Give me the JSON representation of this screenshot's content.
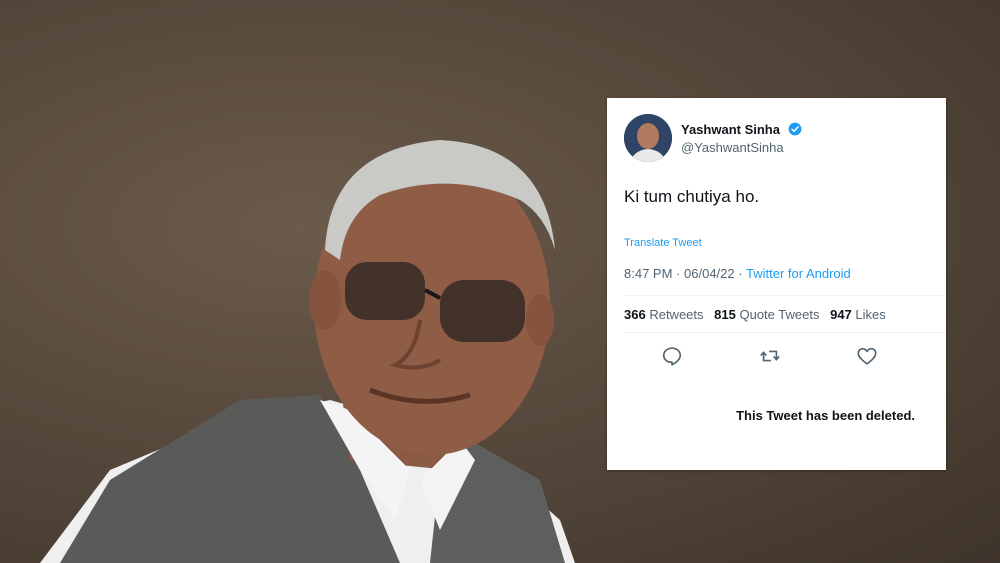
{
  "tweet": {
    "author_name": "Yashwant Sinha",
    "handle": "@YashwantSinha",
    "verified": true,
    "text": "Ki tum chutiya ho.",
    "translate_label": "Translate Tweet",
    "time": "8:47 PM",
    "date": "06/04/22",
    "separator": "·",
    "source": "Twitter for Android",
    "retweets_count": "366",
    "retweets_label": "Retweets",
    "quotes_count": "815",
    "quotes_label": "Quote Tweets",
    "likes_count": "947",
    "likes_label": "Likes",
    "deleted_notice": "This Tweet has been deleted."
  },
  "icons": {
    "verified": "verified-badge-icon",
    "reply": "reply-icon",
    "retweet": "retweet-icon",
    "like": "heart-icon"
  },
  "colors": {
    "accent": "#1d9bf0",
    "text": "#0f1419",
    "secondary": "#536471",
    "background": "#4a3e33"
  }
}
